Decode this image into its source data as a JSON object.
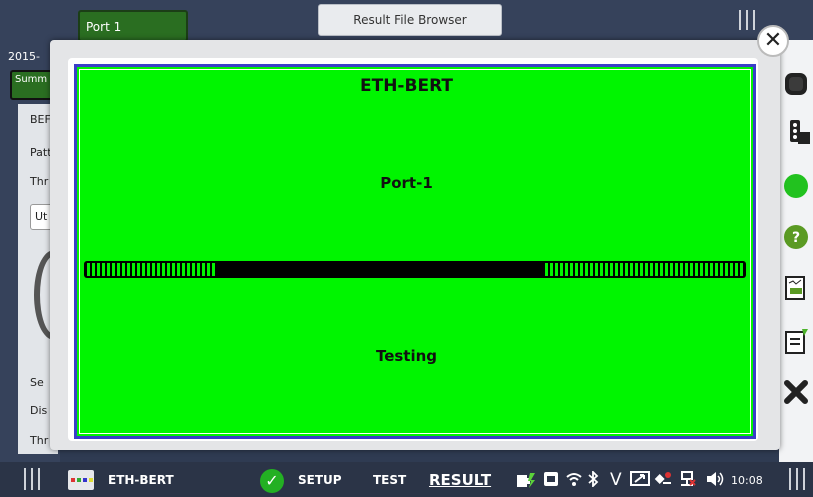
{
  "top": {
    "port_tab": "Port 1",
    "result_tab": "Result File Browser"
  },
  "background": {
    "date": "2015-",
    "summary_tab": "Summ",
    "labels": [
      "BEF",
      "Patt",
      "Thr",
      "Se",
      "Dis",
      "Thr"
    ],
    "field_value": "Ut"
  },
  "modal": {
    "test_name": "ETH-BERT",
    "port": "Port-1",
    "status": "Testing",
    "panel_color": "#00f500",
    "progress_segments": [
      "left-filled",
      "middle-empty",
      "right-filled"
    ]
  },
  "sidebar": {
    "icons": [
      "stop-icon",
      "traffic-light-icon",
      "status-led-icon",
      "help-icon",
      "report-icon",
      "clipboard-edit-icon",
      "reset-icon"
    ]
  },
  "bottom_bar": {
    "test_name": "ETH-BERT",
    "setup": "SETUP",
    "test": "TEST",
    "result": "RESULT",
    "tray_icons": [
      "power-plug-icon",
      "lan-icon",
      "wifi-icon",
      "bluetooth-icon",
      "v-icon",
      "screen-share-icon",
      "satellite-icon",
      "network-icon",
      "volume-icon"
    ],
    "time": "10:08"
  }
}
